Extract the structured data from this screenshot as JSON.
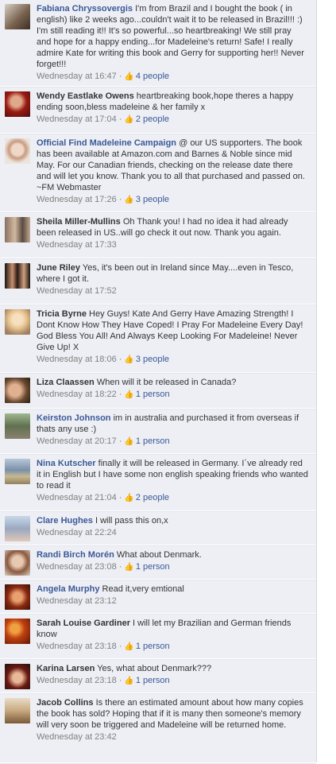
{
  "comments": [
    {
      "author": "Fabiana Chryssovergis",
      "author_link": true,
      "text": "I'm from Brazil and I bought the book ( in english) like 2 weeks ago...couldn't wait it to be released in Brazil!!! :) I'm still reading it!! It's so powerful...so heartbreaking! We still pray and hope for a happy ending...for Madeleine's return! Safe! I really admire Kate for writing this book and Gerry for supporting her!! Never forget!!!",
      "time": "Wednesday at 16:47",
      "likes": "4 people"
    },
    {
      "author": "Wendy Eastlake Owens",
      "author_link": false,
      "text": "heartbreaking book,hope theres a happy ending soon,bless madeleine & her family x",
      "time": "Wednesday at 17:04",
      "likes": "2 people"
    },
    {
      "author": "Official Find Madeleine Campaign",
      "author_link": true,
      "text": "@ our US supporters. The book has been available at Amazon.com and Barnes & Noble since mid May. For our Canadian friends, checking on the release date there and will let you know. Thank you to all that purchased and passed on. ~FM Webmaster",
      "time": "Wednesday at 17:26",
      "likes": "3 people"
    },
    {
      "author": "Sheila Miller-Mullins",
      "author_link": false,
      "text": "Oh Thank you! I had no idea it had already been released in US..will go check it out now. Thank you again.",
      "time": "Wednesday at 17:33",
      "likes": ""
    },
    {
      "author": "June Riley",
      "author_link": false,
      "text": "Yes, it's been out in Ireland since May....even in Tesco, where I got it.",
      "time": "Wednesday at 17:52",
      "likes": ""
    },
    {
      "author": "Tricia Byrne",
      "author_link": false,
      "text": "Hey Guys! Kate And Gerry Have Amazing Strength! I Dont Know How They Have Coped! I Pray For Madeleine Every Day! God Bless You All! And Always Keep Looking For Madeleine! Never Give Up! X",
      "time": "Wednesday at 18:06",
      "likes": "3 people"
    },
    {
      "author": "Liza Claassen",
      "author_link": false,
      "text": "When will it be released in Canada?",
      "time": "Wednesday at 18:22",
      "likes": "1 person"
    },
    {
      "author": "Keirston Johnson",
      "author_link": true,
      "text": "im in australia and purchased it from overseas if thats any use :)",
      "time": "Wednesday at 20:17",
      "likes": "1 person"
    },
    {
      "author": "Nina Kutscher",
      "author_link": true,
      "text": "finally it will be released in Germany. I´ve already red it in English but I have some non english speaking friends who wanted to read it",
      "time": "Wednesday at 21:04",
      "likes": "2 people"
    },
    {
      "author": "Clare Hughes",
      "author_link": true,
      "text": "I will pass this on,x",
      "time": "Wednesday at 22:24",
      "likes": ""
    },
    {
      "author": "Randi Birch Morén",
      "author_link": true,
      "text": "What about Denmark.",
      "time": "Wednesday at 23:08",
      "likes": "1 person"
    },
    {
      "author": "Angela Murphy",
      "author_link": true,
      "text": "Read it,very emtional",
      "time": "Wednesday at 23:12",
      "likes": ""
    },
    {
      "author": "Sarah Louise Gardiner",
      "author_link": false,
      "text": "I will let my Brazilian and German friends know",
      "time": "Wednesday at 23:18",
      "likes": "1 person"
    },
    {
      "author": "Karina Larsen",
      "author_link": false,
      "text": "Yes, what about Denmark???",
      "time": "Wednesday at 23:18",
      "likes": "1 person"
    },
    {
      "author": "Jacob Collins",
      "author_link": false,
      "text": "Is there an estimated amount about how many copies the book has sold? Hoping that if it is many then someone's memory will very soon be triggered and Madeleine will be returned home.",
      "time": "Wednesday at 23:42",
      "likes": ""
    }
  ],
  "separator": "·",
  "icons": {
    "like": "thumbs-up-icon"
  },
  "colors": {
    "link": "#3b5998",
    "meta": "#808080",
    "background": "#edeff4"
  }
}
